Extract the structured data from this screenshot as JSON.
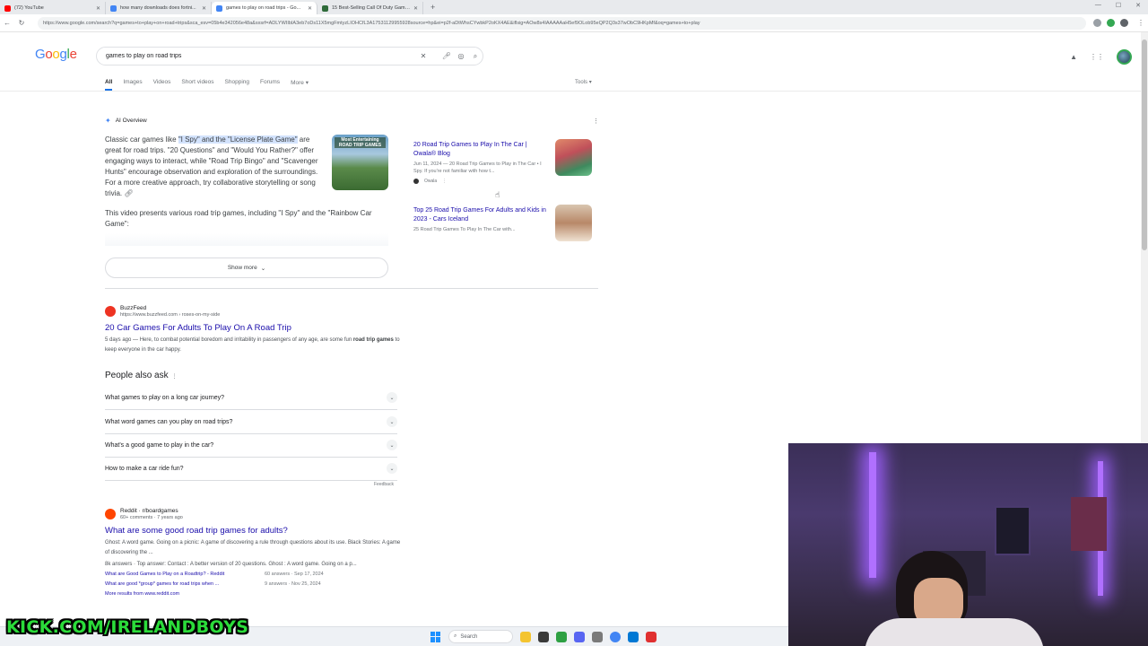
{
  "browser": {
    "tabs": [
      {
        "label": "(72) YouTube",
        "color": "#ff0000",
        "active": false
      },
      {
        "label": "how many downloads does fortni...",
        "color": "#4285f4",
        "active": false
      },
      {
        "label": "games to play on road trips - Go...",
        "color": "#4285f4",
        "active": true
      },
      {
        "label": "15 Best-Selling Call Of Duty Game...",
        "color": "#2f6b3a",
        "active": false
      }
    ],
    "url": "https://www.google.com/search?q=games+to+play+on+road+trips&sca_esv=05b4e342056e48a&sxsrf=ADLYWIIbIA3eb7oDs11X5mgFmtyzLIOHCfL3A17531129955928source=hp&ei=p2f-aDtWhsCYwbkP2oKX4AE&iflsig=AOw8s4IAAAAAaH5ef9OLob95eQP2Q3s37wObC9HKpMf&oq=games+to+play"
  },
  "search": {
    "logo": "Google",
    "query": "games to play on road trips",
    "tabs": [
      "All",
      "Images",
      "Videos",
      "Short videos",
      "Shopping",
      "Forums",
      "More"
    ],
    "tools_label": "Tools"
  },
  "ai_overview": {
    "label": "AI Overview",
    "text_before": "Classic car games like ",
    "highlight": "\"I Spy\" and the \"License Plate Game\"",
    "text_after": " are great for road trips. \"20 Questions\" and \"Would You Rather?\" offer engaging ways to interact, while \"Road Trip Bingo\" and \"Scavenger Hunts\" encourage observation and exploration of the surroundings. For a more creative approach, try collaborative storytelling or song trivia.",
    "text2": "This video presents various road trip games, including \"I Spy\" and the \"Rainbow Car Game\":",
    "thumb_title": "Most Entertaining ROAD TRIP GAMES",
    "show_more": "Show more",
    "sources": [
      {
        "title": "20 Road Trip Games to Play In The Car | Owala® Blog",
        "snippet": "Jun 11, 2024 — 20 Road Trip Games to Play in The Car • I Spy. If you're not familiar with how t...",
        "site": "Owala"
      },
      {
        "title": "Top 25 Road Trip Games For Adults and Kids in 2023 - Cars Iceland",
        "snippet": "25 Road Trip Games To Play In The Car with..."
      }
    ]
  },
  "results": [
    {
      "site": "BuzzFeed",
      "url": "https://www.buzzfeed.com › roses-on-my-side",
      "title": "20 Car Games For Adults To Play On A Road Trip",
      "snippet_date": "5 days ago",
      "snippet": "Here, to combat potential boredom and irritability in passengers of any age, are some fun",
      "snippet_bold": "road trip games",
      "snippet_end": " to keep everyone in the car happy."
    },
    {
      "site": "Reddit · r/boardgames",
      "url": "60+ comments · 7 years ago",
      "title": "What are some good road trip games for adults?",
      "snippet": "Ghost: A word game. Going on a picnic: A game of discovering a rule through questions about its use. Black Stories: A game of discovering the ...",
      "answers_line": "8k answers · Top answer: Contact : A better version of 20 questions. Ghost : A word game. Going on a p...",
      "sublinks": [
        {
          "title": "What are Good Games to Play on a Roadtrip? - Reddit",
          "meta": "60 answers · Sep 17, 2024"
        },
        {
          "title": "What are good *group* games for road trips when ...",
          "meta": "9 answers · Nov 25, 2024"
        }
      ],
      "more": "More results from www.reddit.com"
    }
  ],
  "people_also_ask": {
    "title": "People also ask",
    "questions": [
      "What games to play on a long car journey?",
      "What word games can you play on road trips?",
      "What's a good game to play in the car?",
      "How to make a car ride fun?"
    ],
    "feedback": "Feedback"
  },
  "overlay": {
    "stream_text": "KICK.COM/IRELANDBOYS"
  },
  "taskbar": {
    "search_label": "Search"
  }
}
